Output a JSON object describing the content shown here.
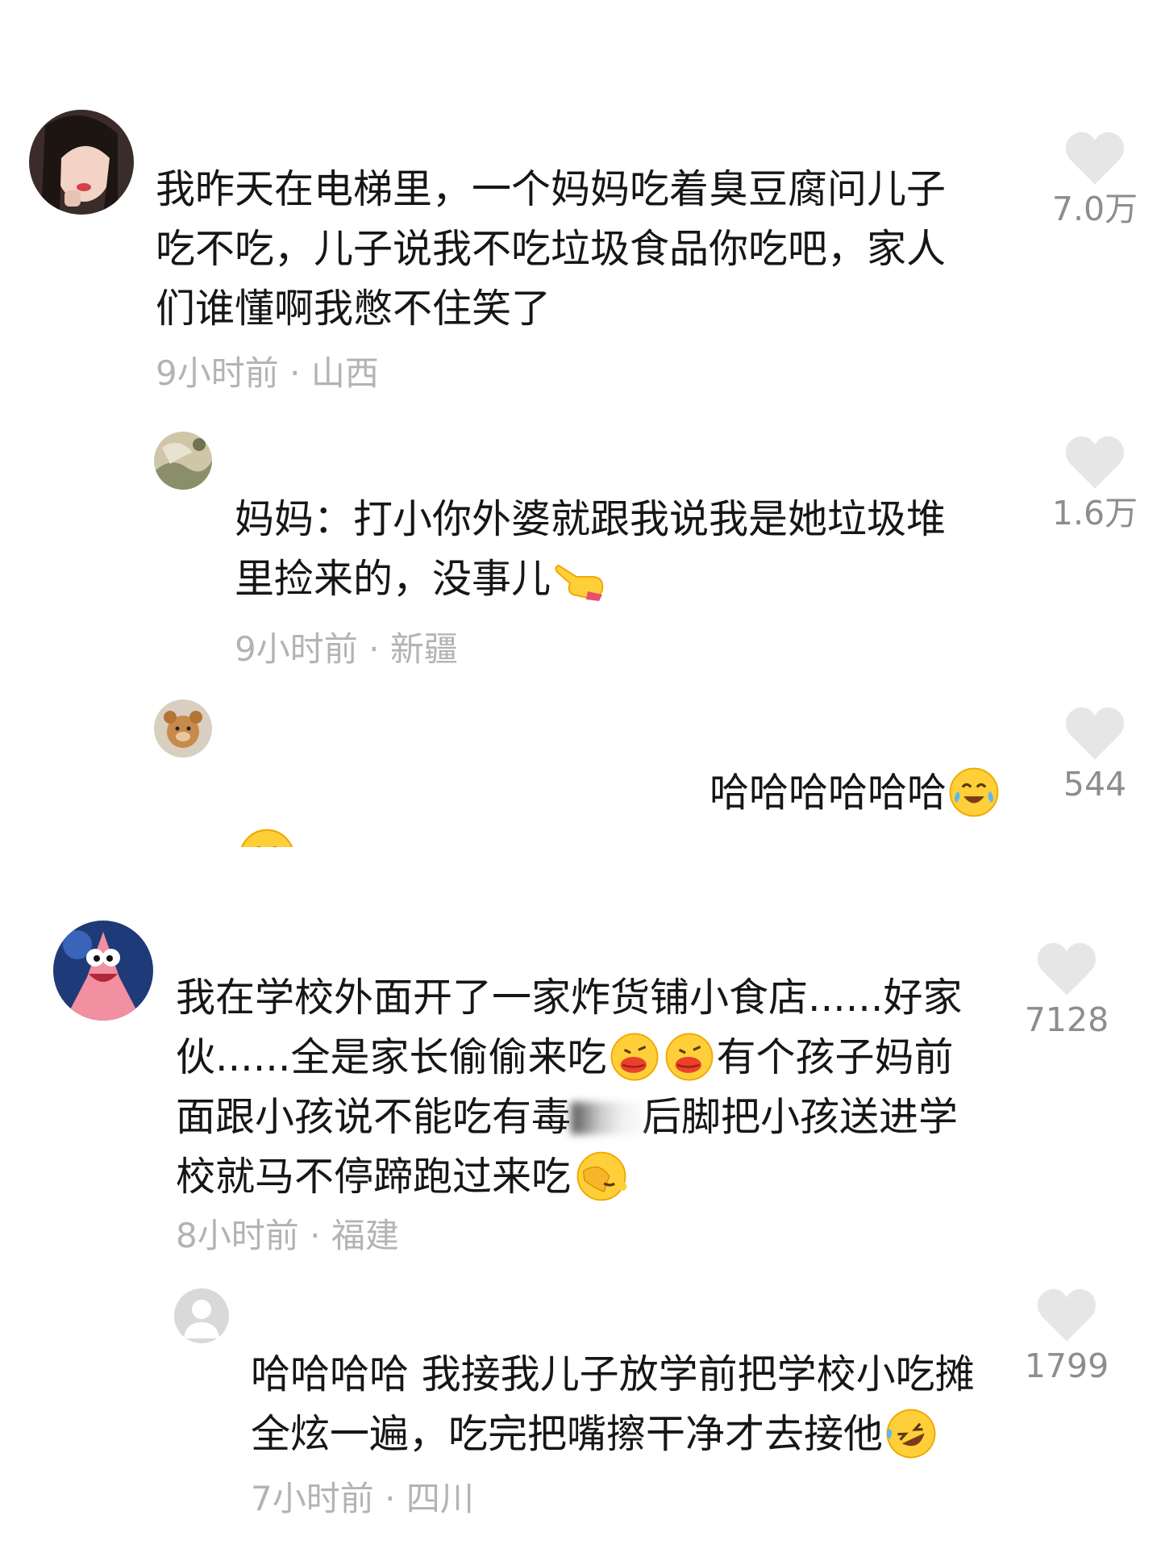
{
  "comments": [
    {
      "text_lines": [
        "我昨天在电梯里，一个妈妈吃着臭豆腐问儿子",
        "吃不吃，儿子说我不吃垃圾食品你吃吧，家人",
        "们谁懂啊我憋不住笑了"
      ],
      "time": "9小时前",
      "location": "山西",
      "likes": "7.0万",
      "avatar_icon": "woman-photo-avatar"
    },
    {
      "text_lines": [
        "妈妈：打小你外婆就跟我说我是她垃圾堆",
        "里捡来的，没事儿"
      ],
      "time": "9小时前",
      "location": "新疆",
      "likes": "1.6万",
      "avatar_icon": "nature-photo-avatar",
      "emoji_icon": "pointing-hand-emoji"
    },
    {
      "text_lines": [
        "哈哈哈哈哈哈"
      ],
      "likes": "544",
      "avatar_icon": "teddy-bear-avatar",
      "emoji_icon": "laughing-crying-emoji"
    },
    {
      "text_lines": [
        "我在学校外面开了一家炸货铺小食店......好家",
        "伙......全是家长偷偷来吃",
        "有个孩子妈前",
        "面跟小孩说不能吃有毒",
        "后脚把小孩送进学",
        "校就马不停蹄跑过来吃"
      ],
      "time": "8小时前",
      "location": "福建",
      "likes": "7128",
      "avatar_icon": "patrick-star-avatar",
      "emoji_icons": [
        "sloppy-kiss-emoji",
        "facepalm-emoji"
      ]
    },
    {
      "text_lines": [
        "哈哈哈哈 我接我儿子放学前把学校小吃摊",
        "全炫一遍，吃完把嘴擦干净才去接他"
      ],
      "time": "7小时前",
      "location": "四川",
      "likes": "1799",
      "avatar_icon": "default-user-avatar",
      "emoji_icon": "rolling-laughing-emoji"
    }
  ],
  "separator": "·",
  "colors": {
    "text": "#161616",
    "meta": "#b3b3b3",
    "count": "#8d8d8d",
    "heart": "#e6e6e6"
  }
}
